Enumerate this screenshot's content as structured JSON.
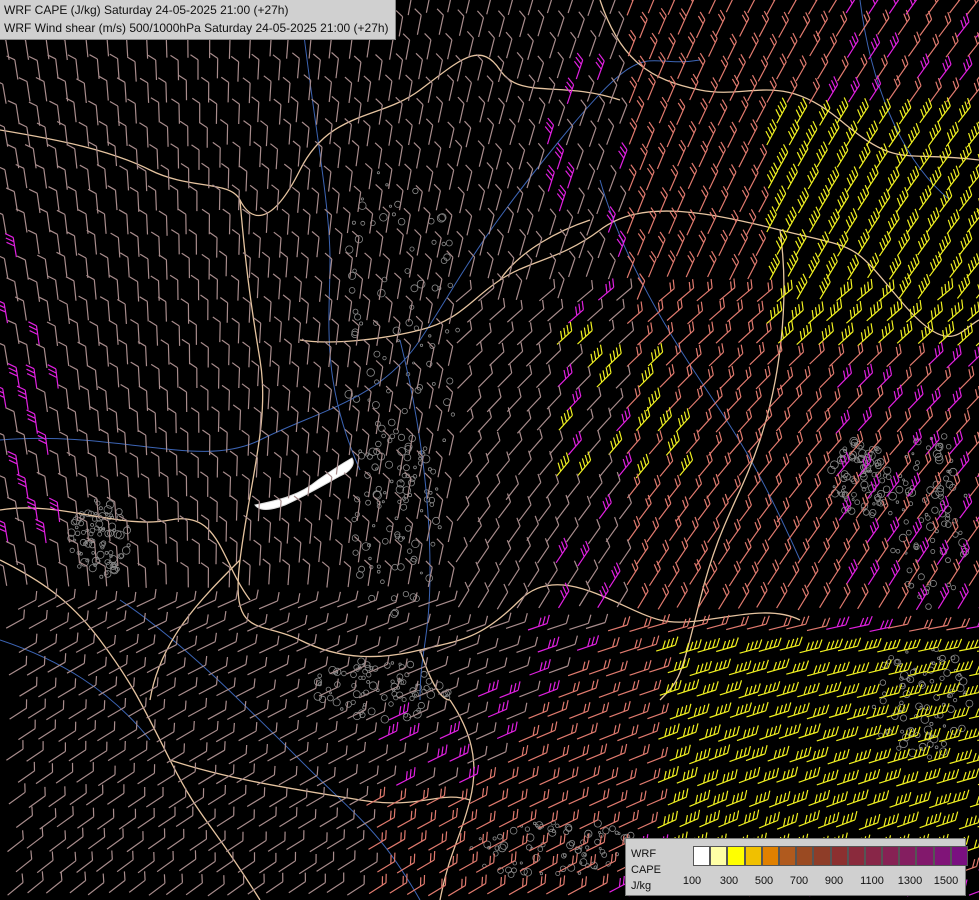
{
  "header": {
    "line1": "WRF CAPE (J/kg) Saturday 24-05-2025 21:00 (+27h)",
    "line2": "WRF Wind shear (m/s) 500/1000hPa Saturday 24-05-2025 21:00 (+27h)"
  },
  "legend": {
    "label_line1": "WRF",
    "label_line2": "CAPE",
    "label_line3": "J/kg",
    "colors": [
      "#ffffff",
      "#ffffa6",
      "#ffff00",
      "#f0c000",
      "#e08000",
      "#b05a1e",
      "#9a4a22",
      "#8e3d28",
      "#8c3030",
      "#8a2a3c",
      "#882648",
      "#862254",
      "#841e60",
      "#82186c",
      "#801478",
      "#7a1080"
    ],
    "ticks": [
      "100",
      "300",
      "500",
      "700",
      "900",
      "1100",
      "1300",
      "1500"
    ]
  },
  "map": {
    "barb_colors": {
      "weak": "#a88c8c",
      "moderate": "#e07a6e",
      "strong": "#e020e0",
      "very_strong": "#f0f020"
    },
    "border_color": "#e6c4a0",
    "river_color": "#3c64b4",
    "terrain_color": "#8a8a8a",
    "lake_color": "#ffffff"
  }
}
